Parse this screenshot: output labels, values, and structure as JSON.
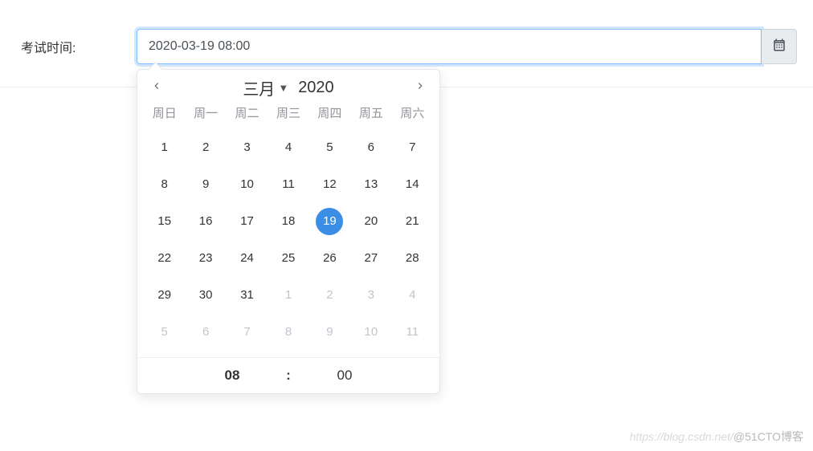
{
  "form": {
    "label": "考试时间:",
    "value": "2020-03-19 08:00"
  },
  "picker": {
    "month_label": "三月",
    "year_label": "2020",
    "dow": [
      "周日",
      "周一",
      "周二",
      "周三",
      "周四",
      "周五",
      "周六"
    ],
    "weeks": [
      [
        {
          "n": "1",
          "cur": true
        },
        {
          "n": "2",
          "cur": true
        },
        {
          "n": "3",
          "cur": true
        },
        {
          "n": "4",
          "cur": true
        },
        {
          "n": "5",
          "cur": true
        },
        {
          "n": "6",
          "cur": true
        },
        {
          "n": "7",
          "cur": true
        }
      ],
      [
        {
          "n": "8",
          "cur": true
        },
        {
          "n": "9",
          "cur": true
        },
        {
          "n": "10",
          "cur": true
        },
        {
          "n": "11",
          "cur": true
        },
        {
          "n": "12",
          "cur": true
        },
        {
          "n": "13",
          "cur": true
        },
        {
          "n": "14",
          "cur": true
        }
      ],
      [
        {
          "n": "15",
          "cur": true
        },
        {
          "n": "16",
          "cur": true
        },
        {
          "n": "17",
          "cur": true
        },
        {
          "n": "18",
          "cur": true
        },
        {
          "n": "19",
          "cur": true,
          "sel": true
        },
        {
          "n": "20",
          "cur": true
        },
        {
          "n": "21",
          "cur": true
        }
      ],
      [
        {
          "n": "22",
          "cur": true
        },
        {
          "n": "23",
          "cur": true
        },
        {
          "n": "24",
          "cur": true
        },
        {
          "n": "25",
          "cur": true
        },
        {
          "n": "26",
          "cur": true
        },
        {
          "n": "27",
          "cur": true
        },
        {
          "n": "28",
          "cur": true
        }
      ],
      [
        {
          "n": "29",
          "cur": true
        },
        {
          "n": "30",
          "cur": true
        },
        {
          "n": "31",
          "cur": true
        },
        {
          "n": "1",
          "cur": false
        },
        {
          "n": "2",
          "cur": false
        },
        {
          "n": "3",
          "cur": false
        },
        {
          "n": "4",
          "cur": false
        }
      ],
      [
        {
          "n": "5",
          "cur": false
        },
        {
          "n": "6",
          "cur": false
        },
        {
          "n": "7",
          "cur": false
        },
        {
          "n": "8",
          "cur": false
        },
        {
          "n": "9",
          "cur": false
        },
        {
          "n": "10",
          "cur": false
        },
        {
          "n": "11",
          "cur": false
        }
      ]
    ],
    "time": {
      "hour": "08",
      "minute": "00",
      "sep": ":"
    }
  },
  "watermark": {
    "left": "https://blog.csdn.net/",
    "right": "@51CTO博客"
  }
}
